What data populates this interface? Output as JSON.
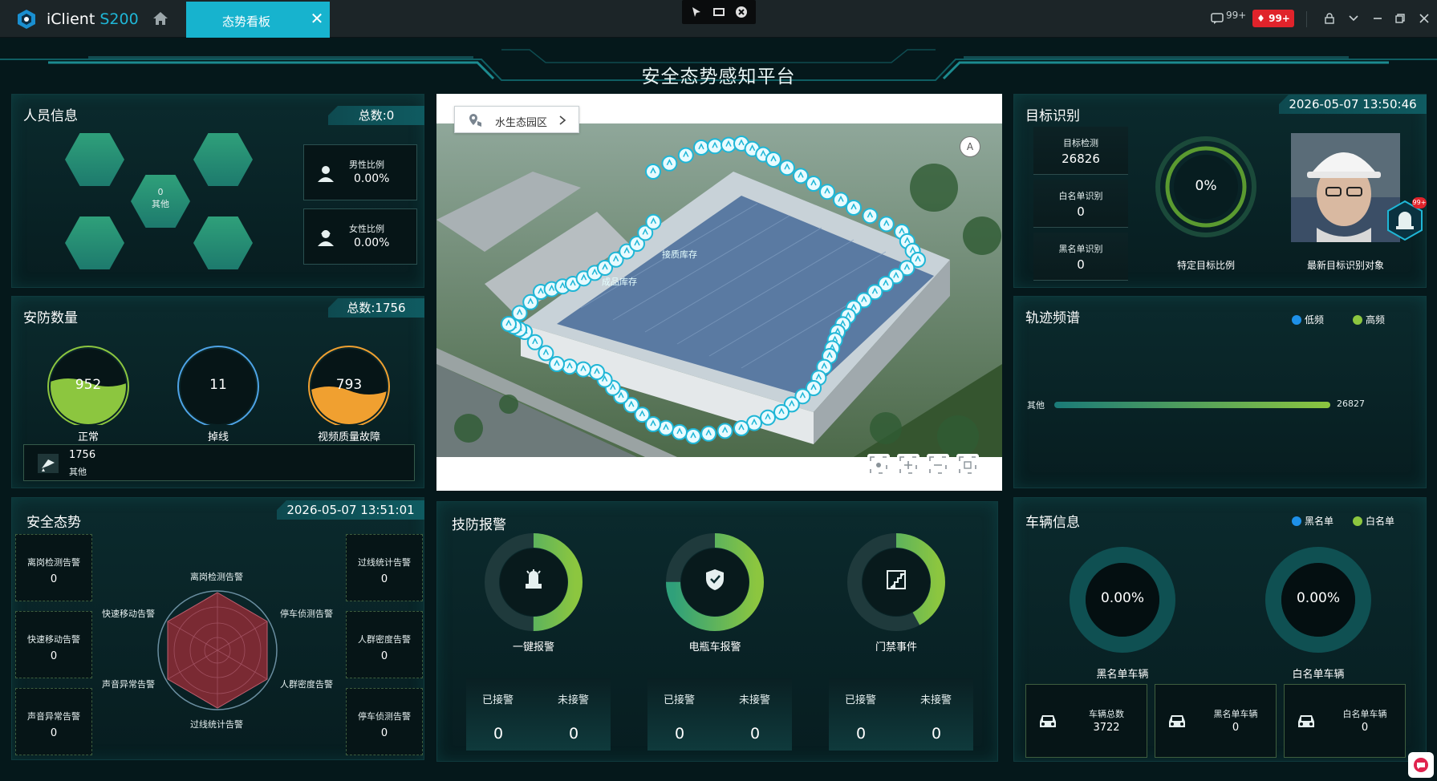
{
  "app": {
    "name": "iClient",
    "model": "S200"
  },
  "tab": {
    "label": "态势看板"
  },
  "header_right": {
    "messages": "99+",
    "alarms": "99+"
  },
  "page_title": "安全态势感知平台",
  "personnel": {
    "title": "人员信息",
    "total": "总数:0",
    "center_value": "0",
    "center_label": "其他",
    "male_label": "男性比例",
    "male_value": "0.00%",
    "female_label": "女性比例",
    "female_value": "0.00%"
  },
  "security": {
    "title": "安防数量",
    "total": "总数:1756",
    "gauges": [
      {
        "label": "正常",
        "value": "952",
        "fill_fraction": 0.55,
        "color": "#8cc63f"
      },
      {
        "label": "掉线",
        "value": "11",
        "fill_fraction": 0.0,
        "color": "#4ea3e6"
      },
      {
        "label": "视频质量故障",
        "value": "793",
        "fill_fraction": 0.45,
        "color": "#f0a030"
      }
    ],
    "other_value": "1756",
    "other_label": "其他"
  },
  "safety": {
    "title": "安全态势",
    "datetime": "2026-05-07 13:51:01",
    "left_boxes": [
      {
        "label": "离岗检测告警",
        "value": "0"
      },
      {
        "label": "快速移动告警",
        "value": "0"
      },
      {
        "label": "声音异常告警",
        "value": "0"
      }
    ],
    "right_boxes": [
      {
        "label": "过线统计告警",
        "value": "0"
      },
      {
        "label": "人群密度告警",
        "value": "0"
      },
      {
        "label": "停车侦测告警",
        "value": "0"
      }
    ],
    "radar_axes": [
      "离岗检测告警",
      "停车侦测告警",
      "人群密度告警",
      "过线统计告警",
      "声音异常告警",
      "快速移动告警"
    ]
  },
  "map": {
    "breadcrumb": "水生态园区",
    "labels": [
      "接质库存",
      "成品库存"
    ]
  },
  "alarm": {
    "title": "技防报警",
    "items": [
      {
        "label": "一键报警",
        "fill_fraction": 0.5,
        "received_label": "已接警",
        "received": "0",
        "unreceived_label": "未接警",
        "unreceived": "0"
      },
      {
        "label": "电瓶车报警",
        "fill_fraction": 0.75,
        "received_label": "已接警",
        "received": "0",
        "unreceived_label": "未接警",
        "unreceived": "0"
      },
      {
        "label": "门禁事件",
        "fill_fraction": 0.42,
        "received_label": "已接警",
        "received": "0",
        "unreceived_label": "未接警",
        "unreceived": "0"
      }
    ]
  },
  "target": {
    "title": "目标识别",
    "datetime": "2026-05-07 13:50:46",
    "stats": [
      {
        "label": "目标检测",
        "value": "26826"
      },
      {
        "label": "白名单识别",
        "value": "0"
      },
      {
        "label": "黑名单识别",
        "value": "0"
      }
    ],
    "ring_value": "0%",
    "ring_label": "特定目标比例",
    "photo_label": "最新目标识别对象",
    "badge": "99+"
  },
  "trajectory": {
    "title": "轨迹频谱",
    "legend_low": "低频",
    "legend_high": "高频",
    "bar_label": "其他",
    "bar_value": "26827",
    "colors": {
      "low": "#1e90e8",
      "high": "#8cc63f"
    }
  },
  "vehicle": {
    "title": "车辆信息",
    "legend_black": "黑名单",
    "legend_white": "白名单",
    "black_ring_value": "0.00%",
    "black_ring_label": "黑名单车辆",
    "white_ring_value": "0.00%",
    "white_ring_label": "白名单车辆",
    "boxes": [
      {
        "label": "车辆总数",
        "value": "3722"
      },
      {
        "label": "黑名单车辆",
        "value": "0"
      },
      {
        "label": "白名单车辆",
        "value": "0"
      }
    ]
  }
}
